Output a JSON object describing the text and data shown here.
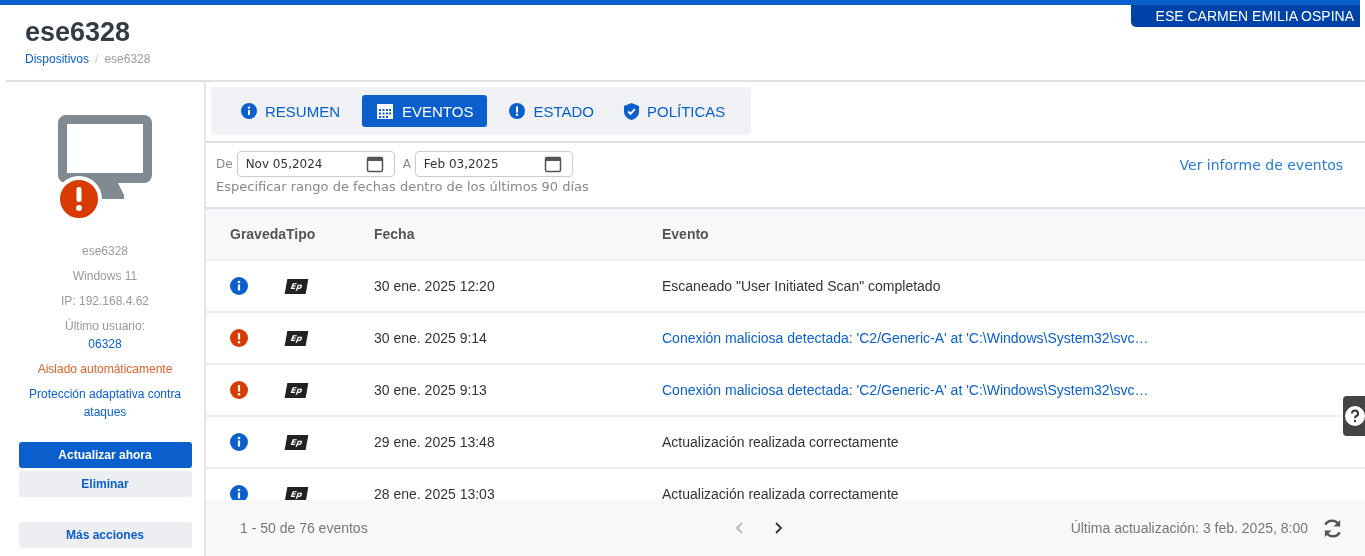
{
  "header": {
    "title": "ese6328",
    "breadcrumb": [
      {
        "label": "Dispositivos",
        "link": true
      },
      {
        "label": "ese6328",
        "link": false
      }
    ],
    "breadcrumb_separator": "/",
    "org_badge": "ESE CARMEN EMILIA OSPINA"
  },
  "sidebar": {
    "alert": true,
    "details": [
      {
        "text": "ese6328",
        "kind": "plain"
      },
      {
        "text": "Windows 11",
        "kind": "plain"
      },
      {
        "text": "IP: 192.168.4.62",
        "kind": "plain"
      },
      {
        "text": "Último usuario:",
        "kind": "plain"
      },
      {
        "text": "06328",
        "kind": "link"
      },
      {
        "text": "Aislado automáticamente",
        "kind": "warning"
      },
      {
        "text": "Protección adaptativa contra ataques",
        "kind": "link"
      }
    ],
    "buttons": [
      {
        "label": "Actualizar ahora",
        "kind": "primary"
      },
      {
        "label": "Eliminar",
        "kind": "secondary"
      },
      {
        "label": "Más acciones",
        "kind": "secondary"
      }
    ]
  },
  "tabs": [
    {
      "label": "RESUMEN",
      "kind": "info",
      "selected": false
    },
    {
      "label": "EVENTOS",
      "kind": "calendar",
      "selected": true
    },
    {
      "label": "ESTADO",
      "kind": "alert",
      "selected": false
    },
    {
      "label": "POLÍTICAS",
      "kind": "shield",
      "selected": false
    }
  ],
  "date_filter": {
    "from_label": "De",
    "from_value": "Nov 05,2024",
    "to_label": "A",
    "to_value": "Feb 03,2025",
    "hint": "Especificar rango de fechas dentro de los últimos 90 días",
    "report_link": "Ver informe de eventos"
  },
  "table": {
    "columns": [
      "Graveda",
      "Tipo",
      "Fecha",
      "Evento"
    ],
    "rows": [
      {
        "kind": "info",
        "type": "Ep",
        "date": "30 ene. 2025 12:20",
        "event": "Escaneado \"User Initiated Scan\" completado",
        "link": false
      },
      {
        "kind": "alert",
        "type": "Ep",
        "date": "30 ene. 2025 9:14",
        "event": "Conexión maliciosa detectada: 'C2/Generic-A' at 'C:\\Windows\\System32\\svc…",
        "link": true
      },
      {
        "kind": "alert",
        "type": "Ep",
        "date": "30 ene. 2025 9:13",
        "event": "Conexión maliciosa detectada: 'C2/Generic-A' at 'C:\\Windows\\System32\\svc…",
        "link": true
      },
      {
        "kind": "info",
        "type": "Ep",
        "date": "29 ene. 2025 13:48",
        "event": "Actualización realizada correctamente",
        "link": false
      },
      {
        "kind": "info",
        "type": "Ep",
        "date": "28 ene. 2025 13:03",
        "event": "Actualización realizada correctamente",
        "link": false
      }
    ]
  },
  "footer": {
    "count": "1 - 50 de 76 eventos",
    "updated": "Última actualización: 3 feb. 2025, 8:00"
  }
}
